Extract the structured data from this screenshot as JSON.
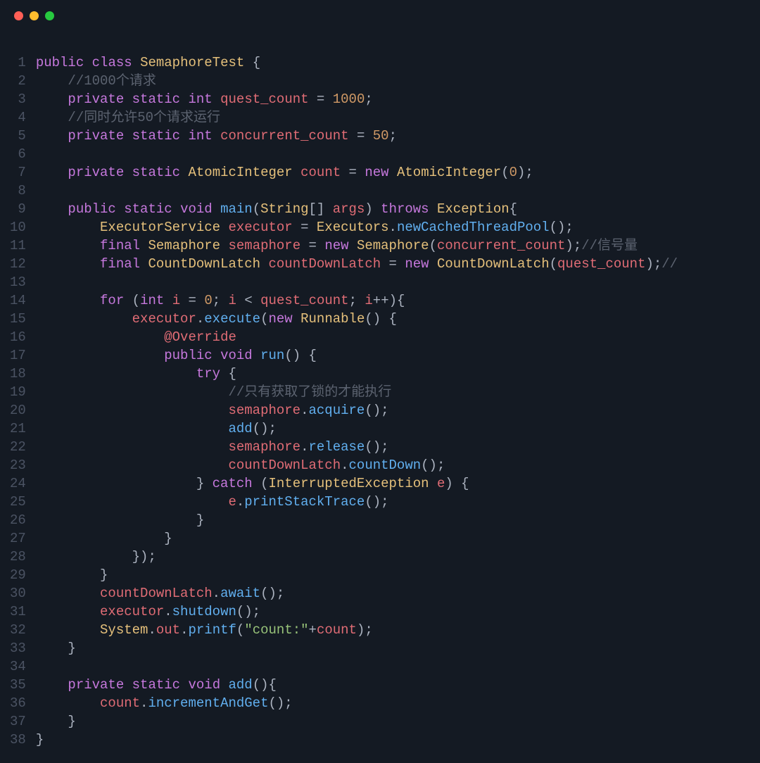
{
  "window": {
    "traffic_lights": [
      "close",
      "minimize",
      "zoom"
    ]
  },
  "code": {
    "language": "java",
    "lines": [
      [
        [
          "kw",
          "public"
        ],
        [
          "pn",
          " "
        ],
        [
          "kw",
          "class"
        ],
        [
          "pn",
          " "
        ],
        [
          "type",
          "SemaphoreTest"
        ],
        [
          "pn",
          " {"
        ]
      ],
      [
        [
          "pn",
          "    "
        ],
        [
          "cmt",
          "//1000个请求"
        ]
      ],
      [
        [
          "pn",
          "    "
        ],
        [
          "kw",
          "private"
        ],
        [
          "pn",
          " "
        ],
        [
          "kw",
          "static"
        ],
        [
          "pn",
          " "
        ],
        [
          "kw",
          "int"
        ],
        [
          "pn",
          " "
        ],
        [
          "var",
          "quest_count"
        ],
        [
          "pn",
          " = "
        ],
        [
          "num",
          "1000"
        ],
        [
          "pn",
          ";"
        ]
      ],
      [
        [
          "pn",
          "    "
        ],
        [
          "cmt",
          "//同时允许50个请求运行"
        ]
      ],
      [
        [
          "pn",
          "    "
        ],
        [
          "kw",
          "private"
        ],
        [
          "pn",
          " "
        ],
        [
          "kw",
          "static"
        ],
        [
          "pn",
          " "
        ],
        [
          "kw",
          "int"
        ],
        [
          "pn",
          " "
        ],
        [
          "var",
          "concurrent_count"
        ],
        [
          "pn",
          " = "
        ],
        [
          "num",
          "50"
        ],
        [
          "pn",
          ";"
        ]
      ],
      [],
      [
        [
          "pn",
          "    "
        ],
        [
          "kw",
          "private"
        ],
        [
          "pn",
          " "
        ],
        [
          "kw",
          "static"
        ],
        [
          "pn",
          " "
        ],
        [
          "type",
          "AtomicInteger"
        ],
        [
          "pn",
          " "
        ],
        [
          "var",
          "count"
        ],
        [
          "pn",
          " = "
        ],
        [
          "kw",
          "new"
        ],
        [
          "pn",
          " "
        ],
        [
          "type",
          "AtomicInteger"
        ],
        [
          "pn",
          "("
        ],
        [
          "num",
          "0"
        ],
        [
          "pn",
          ");"
        ]
      ],
      [],
      [
        [
          "pn",
          "    "
        ],
        [
          "kw",
          "public"
        ],
        [
          "pn",
          " "
        ],
        [
          "kw",
          "static"
        ],
        [
          "pn",
          " "
        ],
        [
          "kw",
          "void"
        ],
        [
          "pn",
          " "
        ],
        [
          "fn",
          "main"
        ],
        [
          "pn",
          "("
        ],
        [
          "type",
          "String"
        ],
        [
          "pn",
          "[] "
        ],
        [
          "var",
          "args"
        ],
        [
          "pn",
          ") "
        ],
        [
          "kw",
          "throws"
        ],
        [
          "pn",
          " "
        ],
        [
          "type",
          "Exception"
        ],
        [
          "pn",
          "{"
        ]
      ],
      [
        [
          "pn",
          "        "
        ],
        [
          "type",
          "ExecutorService"
        ],
        [
          "pn",
          " "
        ],
        [
          "var",
          "executor"
        ],
        [
          "pn",
          " = "
        ],
        [
          "type",
          "Executors"
        ],
        [
          "pn",
          "."
        ],
        [
          "fn",
          "newCachedThreadPool"
        ],
        [
          "pn",
          "();"
        ]
      ],
      [
        [
          "pn",
          "        "
        ],
        [
          "kw",
          "final"
        ],
        [
          "pn",
          " "
        ],
        [
          "type",
          "Semaphore"
        ],
        [
          "pn",
          " "
        ],
        [
          "var",
          "semaphore"
        ],
        [
          "pn",
          " = "
        ],
        [
          "kw",
          "new"
        ],
        [
          "pn",
          " "
        ],
        [
          "type",
          "Semaphore"
        ],
        [
          "pn",
          "("
        ],
        [
          "var",
          "concurrent_count"
        ],
        [
          "pn",
          ");"
        ],
        [
          "cmt",
          "//信号量"
        ]
      ],
      [
        [
          "pn",
          "        "
        ],
        [
          "kw",
          "final"
        ],
        [
          "pn",
          " "
        ],
        [
          "type",
          "CountDownLatch"
        ],
        [
          "pn",
          " "
        ],
        [
          "var",
          "countDownLatch"
        ],
        [
          "pn",
          " = "
        ],
        [
          "kw",
          "new"
        ],
        [
          "pn",
          " "
        ],
        [
          "type",
          "CountDownLatch"
        ],
        [
          "pn",
          "("
        ],
        [
          "var",
          "quest_count"
        ],
        [
          "pn",
          ");"
        ],
        [
          "cmt",
          "//"
        ]
      ],
      [],
      [
        [
          "pn",
          "        "
        ],
        [
          "kw",
          "for"
        ],
        [
          "pn",
          " ("
        ],
        [
          "kw",
          "int"
        ],
        [
          "pn",
          " "
        ],
        [
          "var",
          "i"
        ],
        [
          "pn",
          " = "
        ],
        [
          "num",
          "0"
        ],
        [
          "pn",
          "; "
        ],
        [
          "var",
          "i"
        ],
        [
          "pn",
          " < "
        ],
        [
          "var",
          "quest_count"
        ],
        [
          "pn",
          "; "
        ],
        [
          "var",
          "i"
        ],
        [
          "pn",
          "++){"
        ]
      ],
      [
        [
          "pn",
          "            "
        ],
        [
          "var",
          "executor"
        ],
        [
          "pn",
          "."
        ],
        [
          "fn",
          "execute"
        ],
        [
          "pn",
          "("
        ],
        [
          "kw",
          "new"
        ],
        [
          "pn",
          " "
        ],
        [
          "type",
          "Runnable"
        ],
        [
          "pn",
          "() {"
        ]
      ],
      [
        [
          "pn",
          "                "
        ],
        [
          "ann",
          "@Override"
        ]
      ],
      [
        [
          "pn",
          "                "
        ],
        [
          "kw",
          "public"
        ],
        [
          "pn",
          " "
        ],
        [
          "kw",
          "void"
        ],
        [
          "pn",
          " "
        ],
        [
          "fn",
          "run"
        ],
        [
          "pn",
          "() {"
        ]
      ],
      [
        [
          "pn",
          "                    "
        ],
        [
          "kw",
          "try"
        ],
        [
          "pn",
          " {"
        ]
      ],
      [
        [
          "pn",
          "                        "
        ],
        [
          "cmt",
          "//只有获取了锁的才能执行"
        ]
      ],
      [
        [
          "pn",
          "                        "
        ],
        [
          "var",
          "semaphore"
        ],
        [
          "pn",
          "."
        ],
        [
          "fn",
          "acquire"
        ],
        [
          "pn",
          "();"
        ]
      ],
      [
        [
          "pn",
          "                        "
        ],
        [
          "fn",
          "add"
        ],
        [
          "pn",
          "();"
        ]
      ],
      [
        [
          "pn",
          "                        "
        ],
        [
          "var",
          "semaphore"
        ],
        [
          "pn",
          "."
        ],
        [
          "fn",
          "release"
        ],
        [
          "pn",
          "();"
        ]
      ],
      [
        [
          "pn",
          "                        "
        ],
        [
          "var",
          "countDownLatch"
        ],
        [
          "pn",
          "."
        ],
        [
          "fn",
          "countDown"
        ],
        [
          "pn",
          "();"
        ]
      ],
      [
        [
          "pn",
          "                    } "
        ],
        [
          "kw",
          "catch"
        ],
        [
          "pn",
          " ("
        ],
        [
          "type",
          "InterruptedException"
        ],
        [
          "pn",
          " "
        ],
        [
          "var",
          "e"
        ],
        [
          "pn",
          ") {"
        ]
      ],
      [
        [
          "pn",
          "                        "
        ],
        [
          "var",
          "e"
        ],
        [
          "pn",
          "."
        ],
        [
          "fn",
          "printStackTrace"
        ],
        [
          "pn",
          "();"
        ]
      ],
      [
        [
          "pn",
          "                    }"
        ]
      ],
      [
        [
          "pn",
          "                }"
        ]
      ],
      [
        [
          "pn",
          "            });"
        ]
      ],
      [
        [
          "pn",
          "        }"
        ]
      ],
      [
        [
          "pn",
          "        "
        ],
        [
          "var",
          "countDownLatch"
        ],
        [
          "pn",
          "."
        ],
        [
          "fn",
          "await"
        ],
        [
          "pn",
          "();"
        ]
      ],
      [
        [
          "pn",
          "        "
        ],
        [
          "var",
          "executor"
        ],
        [
          "pn",
          "."
        ],
        [
          "fn",
          "shutdown"
        ],
        [
          "pn",
          "();"
        ]
      ],
      [
        [
          "pn",
          "        "
        ],
        [
          "type",
          "System"
        ],
        [
          "pn",
          "."
        ],
        [
          "var",
          "out"
        ],
        [
          "pn",
          "."
        ],
        [
          "fn",
          "printf"
        ],
        [
          "pn",
          "("
        ],
        [
          "str",
          "\"count:\""
        ],
        [
          "pn",
          "+"
        ],
        [
          "var",
          "count"
        ],
        [
          "pn",
          ");"
        ]
      ],
      [
        [
          "pn",
          "    }"
        ]
      ],
      [],
      [
        [
          "pn",
          "    "
        ],
        [
          "kw",
          "private"
        ],
        [
          "pn",
          " "
        ],
        [
          "kw",
          "static"
        ],
        [
          "pn",
          " "
        ],
        [
          "kw",
          "void"
        ],
        [
          "pn",
          " "
        ],
        [
          "fn",
          "add"
        ],
        [
          "pn",
          "(){"
        ]
      ],
      [
        [
          "pn",
          "        "
        ],
        [
          "var",
          "count"
        ],
        [
          "pn",
          "."
        ],
        [
          "fn",
          "incrementAndGet"
        ],
        [
          "pn",
          "();"
        ]
      ],
      [
        [
          "pn",
          "    }"
        ]
      ],
      [
        [
          "pn",
          "}"
        ]
      ]
    ]
  }
}
